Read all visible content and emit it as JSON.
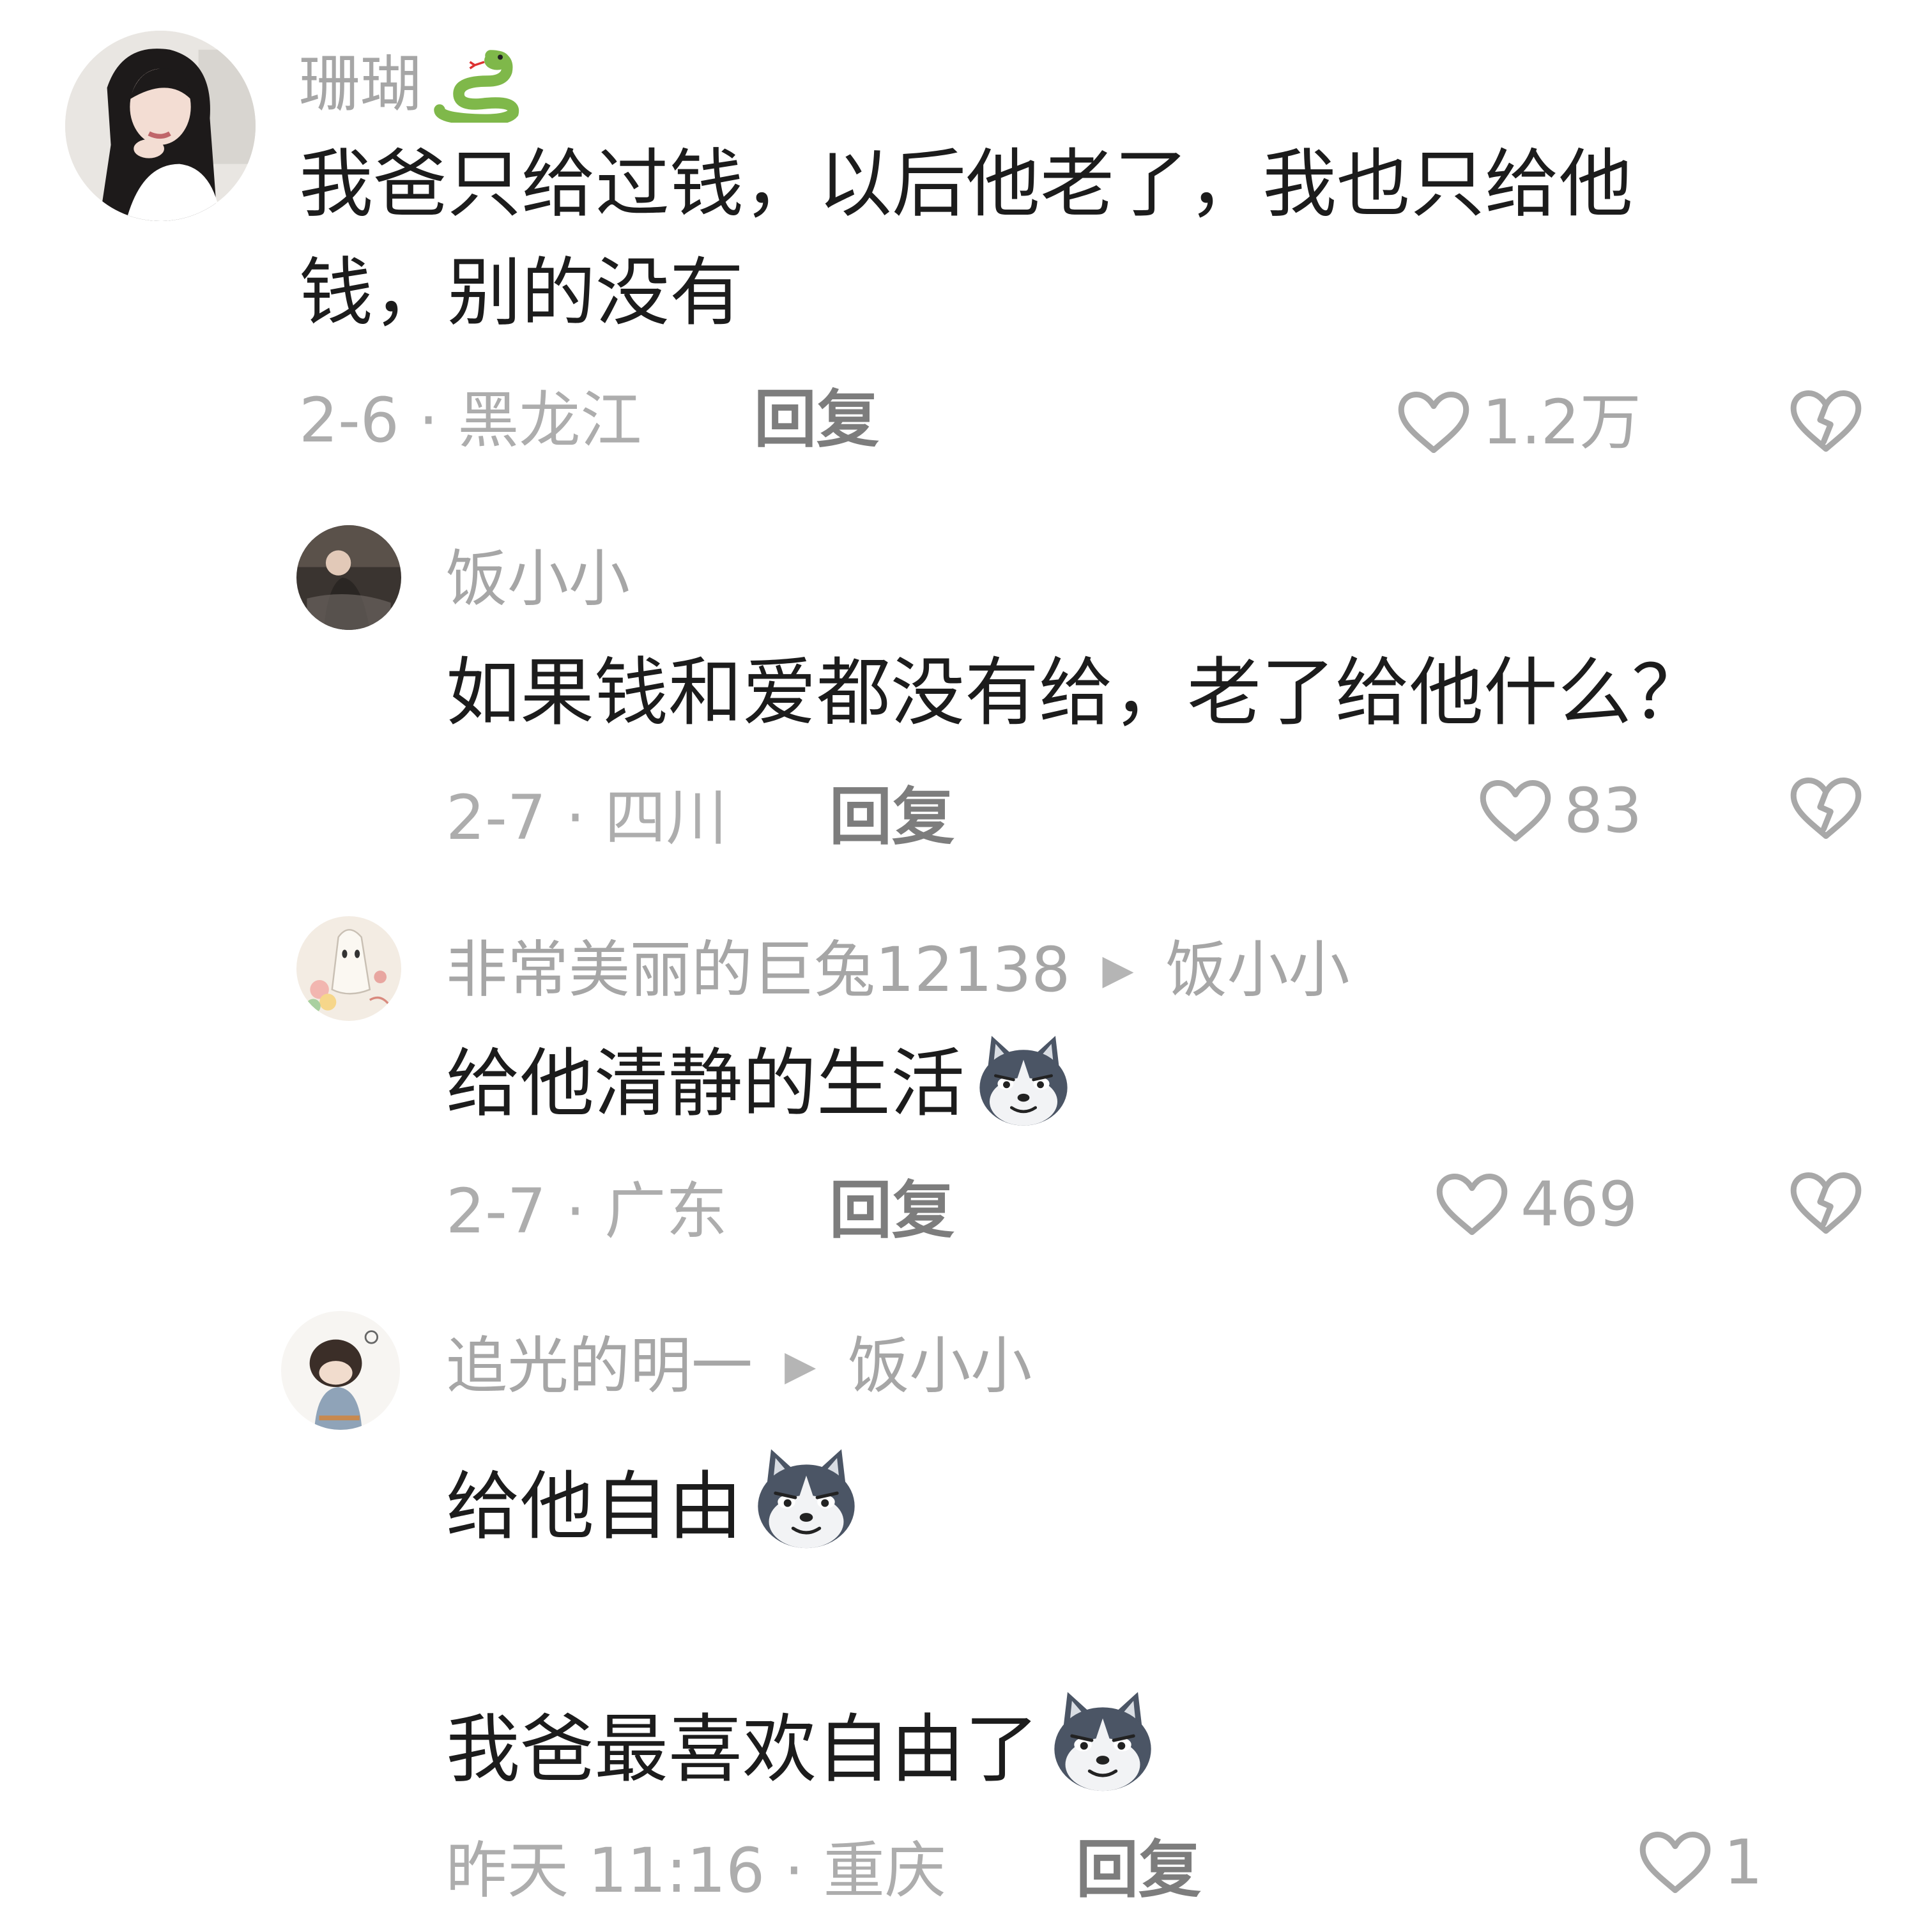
{
  "comments": [
    {
      "username": "珊瑚",
      "user_emoji": "snake-icon",
      "text_lines": [
        "我爸只给过钱，以后他老了，我也只给他",
        "钱，别的没有"
      ],
      "meta": "2-6 · 黑龙江",
      "reply_label": "回复",
      "likes": "1.2万"
    },
    {
      "username": "饭小小",
      "text_lines": [
        "如果钱和爱都没有给，老了给他什么？"
      ],
      "meta": "2-7 · 四川",
      "reply_label": "回复",
      "likes": "83"
    },
    {
      "username": "非常美丽的巨兔12138",
      "reply_to": "饭小小",
      "text_lines": [
        "给他清静的生活"
      ],
      "text_emoji": "husky-dog-emoji",
      "meta": "2-7 · 广东",
      "reply_label": "回复",
      "likes": "469"
    },
    {
      "username": "追光的明一",
      "reply_to": "饭小小",
      "text_lines": [
        "给他自由",
        "",
        "我爸最喜欢自由了"
      ],
      "text_emoji": "husky-dog-emoji",
      "meta": "昨天 11:16 · 重庆",
      "reply_label": "回复",
      "likes": "1"
    }
  ],
  "colors": {
    "text": "#1c1c1c",
    "username": "#a6a6a6",
    "meta": "#adadad",
    "reply": "#7d7d7d",
    "icons": "#b0b0b0"
  }
}
